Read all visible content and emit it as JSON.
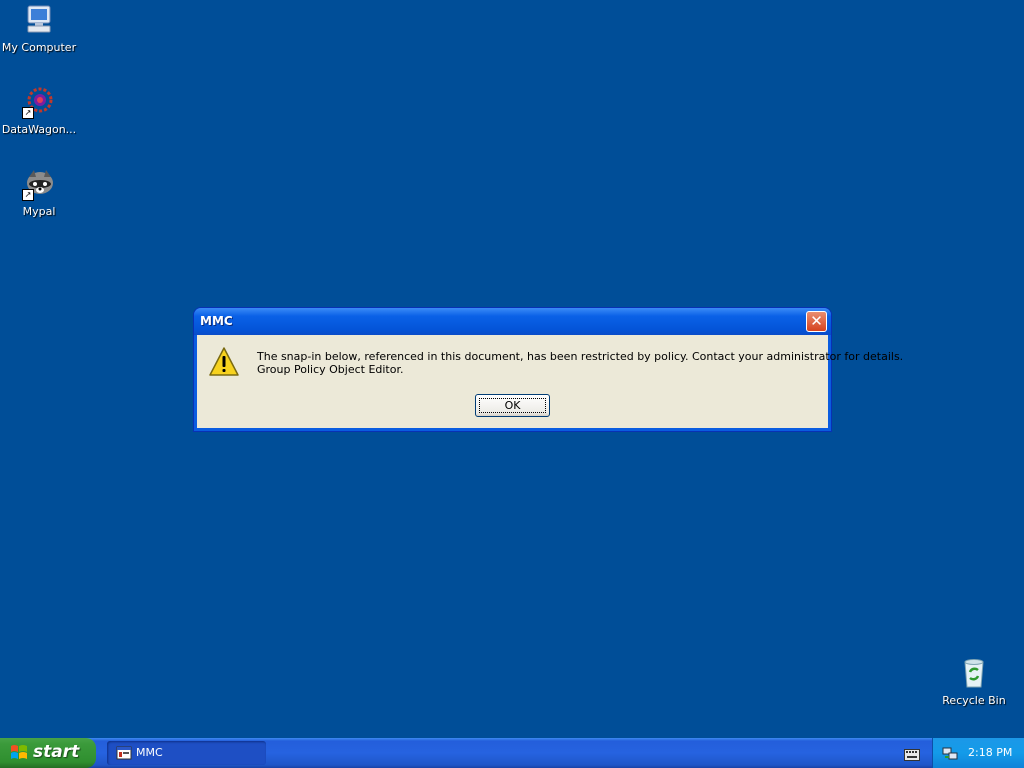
{
  "desktop": {
    "icons": [
      {
        "label": "My Computer"
      },
      {
        "label": "DataWagon..."
      },
      {
        "label": "Mypal"
      },
      {
        "label": "Recycle Bin"
      }
    ]
  },
  "dialog": {
    "title": "MMC",
    "message_line1": "The snap-in below, referenced in this document, has been restricted by policy. Contact your administrator for details.",
    "message_line2": "Group Policy Object Editor.",
    "ok_label": "OK",
    "icon": "warning-icon"
  },
  "taskbar": {
    "start_label": "start",
    "tasks": [
      {
        "label": "MMC",
        "icon": "mmc-icon"
      }
    ],
    "clock": "2:18 PM"
  },
  "colors": {
    "desktop_bg": "#004e98",
    "titlebar": "#0a61e7",
    "dialog_client": "#ece9d8",
    "start_green": "#3b9a3b",
    "tray_blue": "#139be9"
  }
}
